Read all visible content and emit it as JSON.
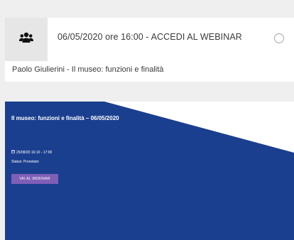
{
  "event_row": {
    "icon": "people-group-icon",
    "title": "06/05/2020 ore 16:00 - ACCEDI AL WEBINAR",
    "speaker_line": "Paolo Giulierini - Il museo: funzioni e finalità"
  },
  "banner": {
    "title": "Il museo: funzioni e finalità – 06/05/2020",
    "date_time": "25/08/20 16:10 - 17:00",
    "status": "Status: Pronotato",
    "button_label": "VAI AL WEBINAR",
    "colors": {
      "background": "#1b3f8f",
      "button": "#7f5fb6"
    }
  }
}
